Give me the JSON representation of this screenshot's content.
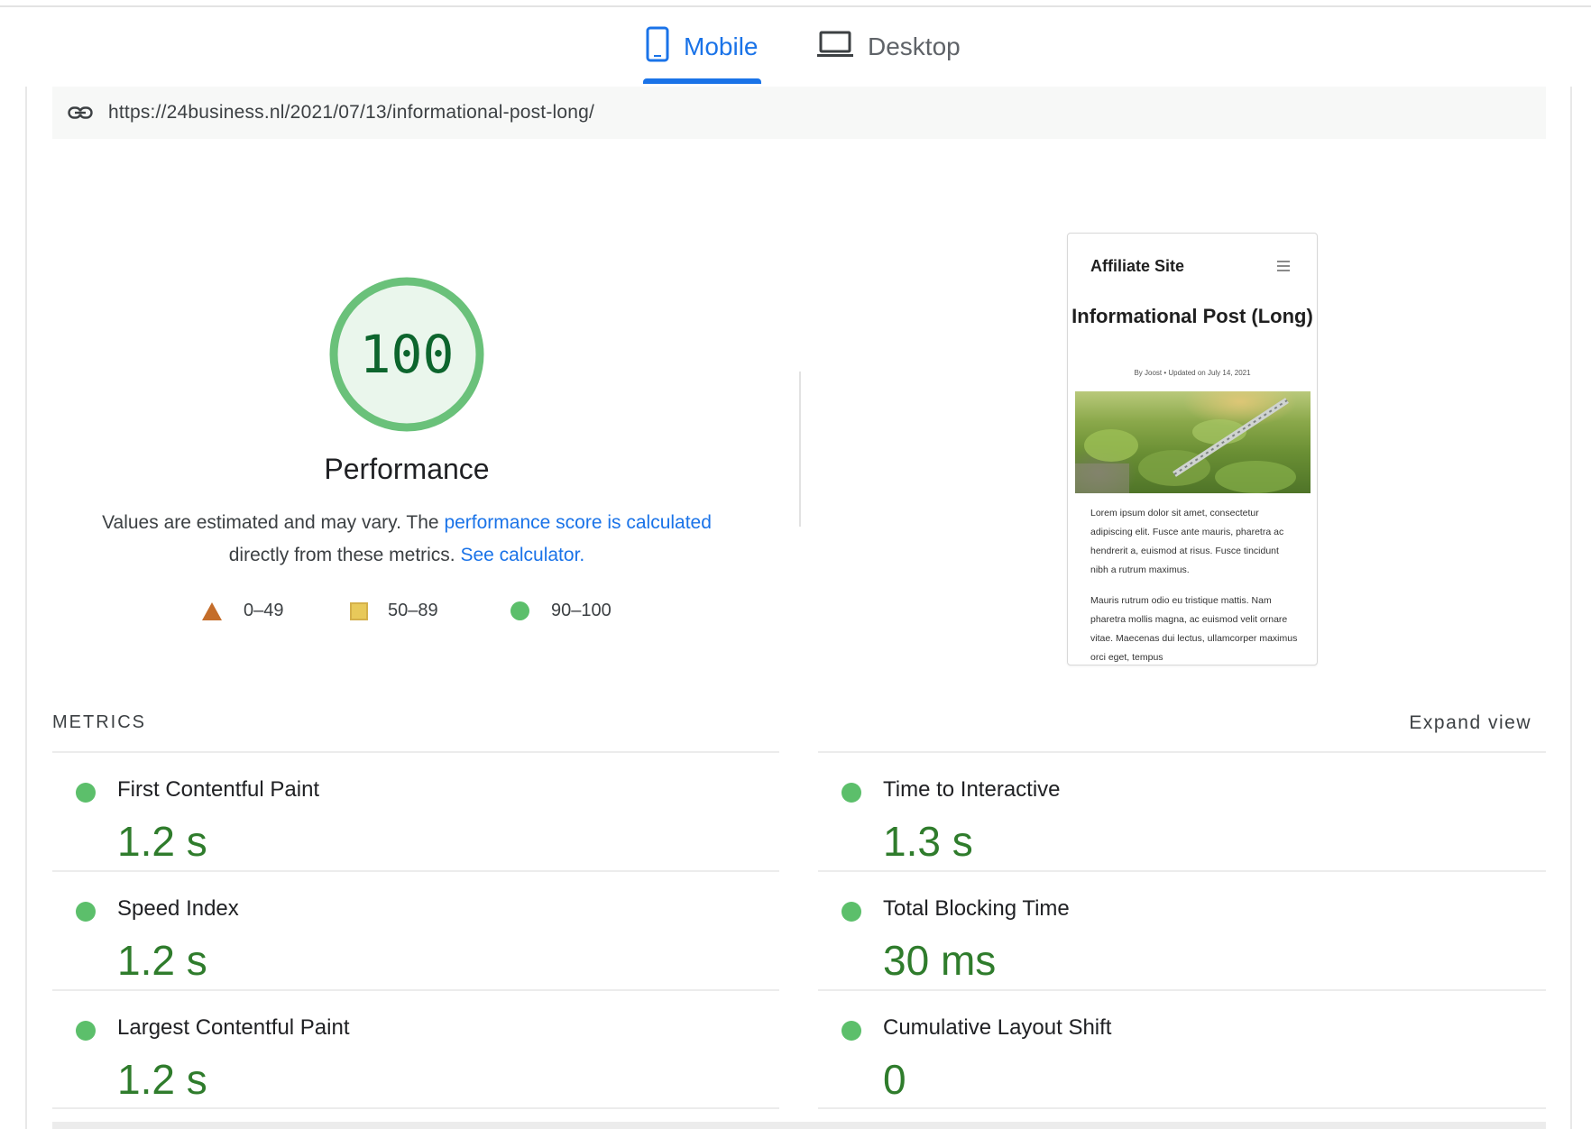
{
  "tabs": {
    "mobile": {
      "label": "Mobile",
      "icon": "phone-icon",
      "active": true
    },
    "desktop": {
      "label": "Desktop",
      "icon": "laptop-icon",
      "active": false
    }
  },
  "url": {
    "icon": "link-icon",
    "value": "https://24business.nl/2021/07/13/informational-post-long/"
  },
  "performance": {
    "score": "100",
    "score_value": 100,
    "title": "Performance",
    "desc_prefix": "Values are estimated and may vary. The ",
    "desc_link1": "performance score is calculated",
    "desc_middle": " directly from these metrics. ",
    "desc_link2": "See calculator."
  },
  "legend": [
    {
      "range": "0–49",
      "icon": "triangle-icon",
      "color": "#c46d2a"
    },
    {
      "range": "50–89",
      "icon": "square-icon",
      "color": "#e8c95a"
    },
    {
      "range": "90–100",
      "icon": "circle-icon",
      "color": "#5cbf6b"
    }
  ],
  "screenshot": {
    "site_name": "Affiliate Site",
    "menu_icon": "hamburger-icon",
    "post_title": "Informational Post (Long)",
    "meta": "By Joost  •  Updated on July 14, 2021",
    "body1": "Lorem ipsum dolor sit amet, consectetur adipiscing elit. Fusce ante mauris, pharetra ac hendrerit a, euismod at risus. Fusce tincidunt nibh a rutrum maximus.",
    "body2": "Mauris rutrum odio eu tristique mattis. Nam pharetra mollis magna, ac euismod velit ornare vitae. Maecenas dui lectus, ullamcorper maximus orci eget, tempus"
  },
  "metrics": {
    "header": "METRICS",
    "expand_label": "Expand view",
    "left": [
      {
        "name": "First Contentful Paint",
        "value": "1.2 s"
      },
      {
        "name": "Speed Index",
        "value": "1.2 s"
      },
      {
        "name": "Largest Contentful Paint",
        "value": "1.2 s"
      }
    ],
    "right": [
      {
        "name": "Time to Interactive",
        "value": "1.3 s"
      },
      {
        "name": "Total Blocking Time",
        "value": "30 ms"
      },
      {
        "name": "Cumulative Layout Shift",
        "value": "0"
      }
    ],
    "status_color": "#5cbf6b"
  }
}
